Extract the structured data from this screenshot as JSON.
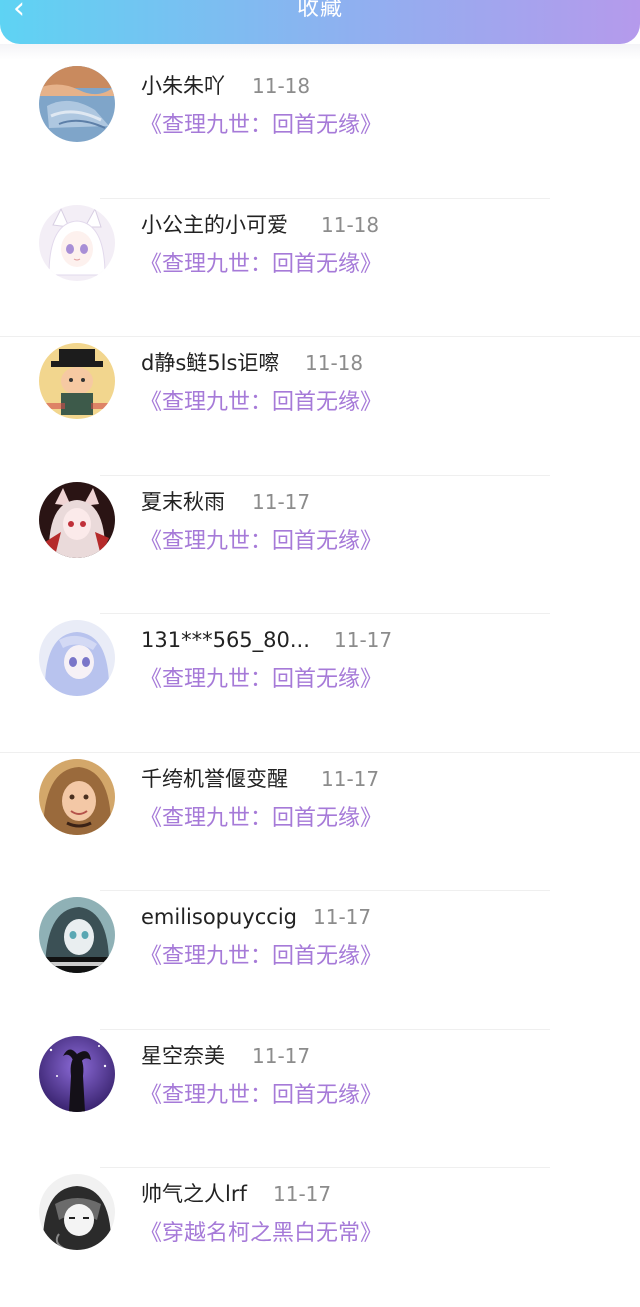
{
  "header": {
    "title": "收藏",
    "back_icon": "‹"
  },
  "colors": {
    "accent": "#a67ad8",
    "header_start": "#5ed3f3",
    "header_end": "#b59aec"
  },
  "items": [
    {
      "name": "小朱朱吖",
      "date": "11-18",
      "work": "《查理九世：回首无缘》",
      "avatar": "avatar-fabric"
    },
    {
      "name": "小公主的小可爱",
      "date": "11-18",
      "work": "《查理九世：回首无缘》",
      "avatar": "avatar-anime-white"
    },
    {
      "name": "d静s鲢5ls讵嚓",
      "date": "11-18",
      "work": "《查理九世：回首无缘》",
      "avatar": "avatar-hat-character"
    },
    {
      "name": "夏末秋雨",
      "date": "11-17",
      "work": "《查理九世：回首无缘》",
      "avatar": "avatar-anime-red"
    },
    {
      "name": "131***565_80...",
      "date": "11-17",
      "work": "《查理九世：回首无缘》",
      "avatar": "avatar-anime-blue"
    },
    {
      "name": "千绔机誉偃变醒",
      "date": "11-17",
      "work": "《查理九世：回首无缘》",
      "avatar": "avatar-girl-photo"
    },
    {
      "name": "emilisopuyccig",
      "date": "11-17",
      "work": "《查理九世：回首无缘》",
      "avatar": "avatar-teal-portrait"
    },
    {
      "name": "星空奈美",
      "date": "11-17",
      "work": "《查理九世：回首无缘》",
      "avatar": "avatar-silhouette"
    },
    {
      "name": "帅气之人lrf",
      "date": "11-17",
      "work": "《穿越名柯之黑白无常》",
      "avatar": "avatar-sketch"
    }
  ]
}
